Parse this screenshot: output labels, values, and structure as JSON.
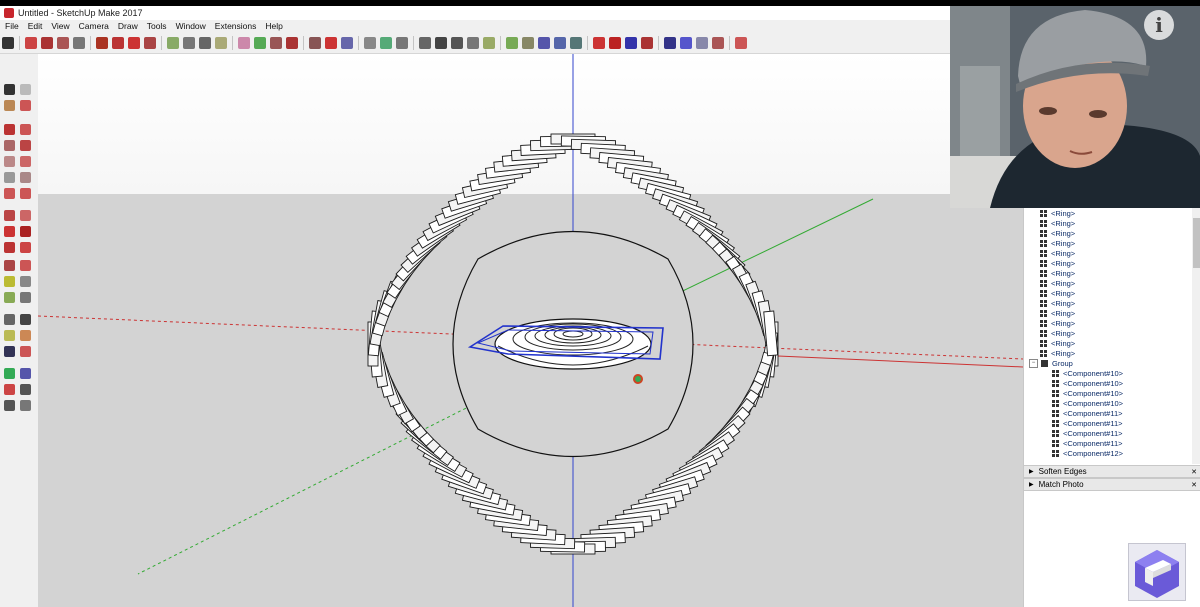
{
  "window": {
    "title": "Untitled - SketchUp Make 2017"
  },
  "menu": [
    "File",
    "Edit",
    "View",
    "Camera",
    "Draw",
    "Tools",
    "Window",
    "Extensions",
    "Help"
  ],
  "outliner": {
    "rows": [
      {
        "label": "<Ring>",
        "indent": 1,
        "kind": "component"
      },
      {
        "label": "<Ring>",
        "indent": 1,
        "kind": "component"
      },
      {
        "label": "<Ring>",
        "indent": 1,
        "kind": "component"
      },
      {
        "label": "<Ring>",
        "indent": 1,
        "kind": "component"
      },
      {
        "label": "<Ring>",
        "indent": 1,
        "kind": "component"
      },
      {
        "label": "<Ring>",
        "indent": 1,
        "kind": "component"
      },
      {
        "label": "<Ring>",
        "indent": 1,
        "kind": "component"
      },
      {
        "label": "<Ring>",
        "indent": 1,
        "kind": "component"
      },
      {
        "label": "<Ring>",
        "indent": 1,
        "kind": "component"
      },
      {
        "label": "<Ring>",
        "indent": 1,
        "kind": "component"
      },
      {
        "label": "<Ring>",
        "indent": 1,
        "kind": "component"
      },
      {
        "label": "<Ring>",
        "indent": 1,
        "kind": "component"
      },
      {
        "label": "<Ring>",
        "indent": 1,
        "kind": "component"
      },
      {
        "label": "<Ring>",
        "indent": 1,
        "kind": "component"
      },
      {
        "label": "<Ring>",
        "indent": 1,
        "kind": "component"
      },
      {
        "label": "Group",
        "indent": 0,
        "kind": "group"
      },
      {
        "label": "<Component#10>",
        "indent": 2,
        "kind": "component"
      },
      {
        "label": "<Component#10>",
        "indent": 2,
        "kind": "component"
      },
      {
        "label": "<Component#10>",
        "indent": 2,
        "kind": "component"
      },
      {
        "label": "<Component#10>",
        "indent": 2,
        "kind": "component"
      },
      {
        "label": "<Component#11>",
        "indent": 2,
        "kind": "component"
      },
      {
        "label": "<Component#11>",
        "indent": 2,
        "kind": "component"
      },
      {
        "label": "<Component#11>",
        "indent": 2,
        "kind": "component"
      },
      {
        "label": "<Component#11>",
        "indent": 2,
        "kind": "component"
      },
      {
        "label": "<Component#12>",
        "indent": 2,
        "kind": "component"
      }
    ]
  },
  "trays": {
    "soften_edges": "Soften Edges",
    "match_photo": "Match Photo"
  },
  "info_button": "i",
  "colors": {
    "accent": "#c8262d",
    "selection": "#2233cc",
    "axis_red": "#cc3333",
    "axis_green": "#33aa33",
    "axis_blue": "#3344cc"
  }
}
